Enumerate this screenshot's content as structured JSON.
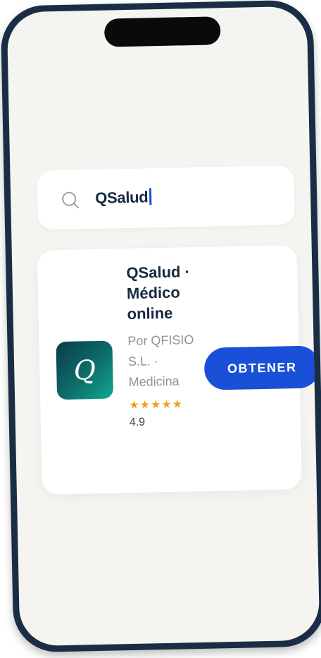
{
  "search": {
    "query": "QSalud"
  },
  "result": {
    "icon_letter": "Q",
    "name": "QSalud · Médico online",
    "developer_line": "Por QFISIO S.L. · Medicina",
    "stars": "★★★★★",
    "rating": "4.9",
    "button_label": "OBTENER"
  },
  "colors": {
    "accent": "#1a4fd8",
    "stars": "#f1a01c",
    "text_primary": "#162a3f",
    "text_secondary": "#8d949d",
    "background": "#f5f4f0",
    "frame": "#1b2d45"
  }
}
